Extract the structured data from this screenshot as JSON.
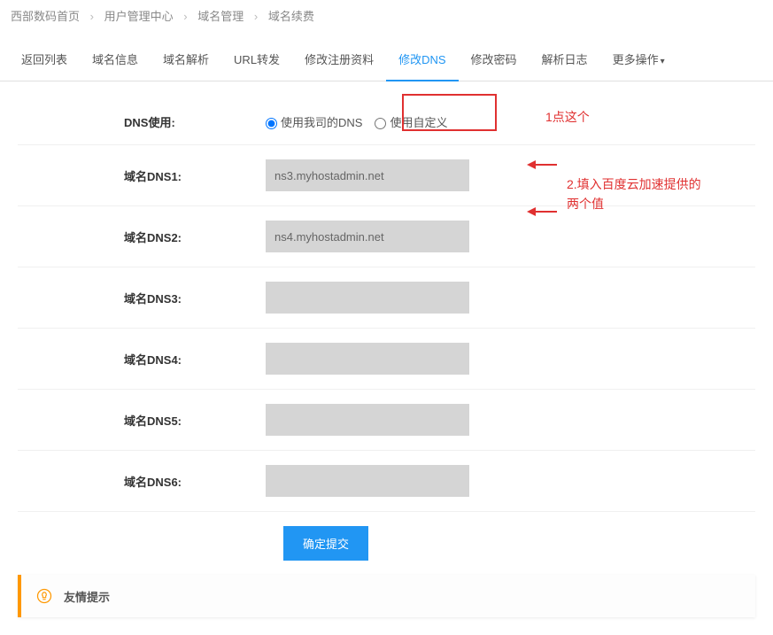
{
  "breadcrumb": {
    "items": [
      "西部数码首页",
      "用户管理中心",
      "域名管理",
      "域名续费"
    ]
  },
  "tabs": {
    "items": [
      {
        "label": "返回列表"
      },
      {
        "label": "域名信息"
      },
      {
        "label": "域名解析"
      },
      {
        "label": "URL转发"
      },
      {
        "label": "修改注册资料"
      },
      {
        "label": "修改DNS",
        "active": true
      },
      {
        "label": "修改密码"
      },
      {
        "label": "解析日志"
      },
      {
        "label": "更多操作",
        "dropdown": true
      }
    ]
  },
  "form": {
    "dns_use_label": "DNS使用:",
    "radio_company": "使用我司的DNS",
    "radio_custom": "使用自定义",
    "dns1_label": "域名DNS1:",
    "dns1_value": "ns3.myhostadmin.net",
    "dns2_label": "域名DNS2:",
    "dns2_value": "ns4.myhostadmin.net",
    "dns3_label": "域名DNS3:",
    "dns3_value": "",
    "dns4_label": "域名DNS4:",
    "dns4_value": "",
    "dns5_label": "域名DNS5:",
    "dns5_value": "",
    "dns6_label": "域名DNS6:",
    "dns6_value": "",
    "submit_label": "确定提交"
  },
  "help": {
    "title": "友情提示"
  },
  "annotations": {
    "anno1": "1点这个",
    "anno2": "2.填入百度云加速提供的\n两个值"
  }
}
